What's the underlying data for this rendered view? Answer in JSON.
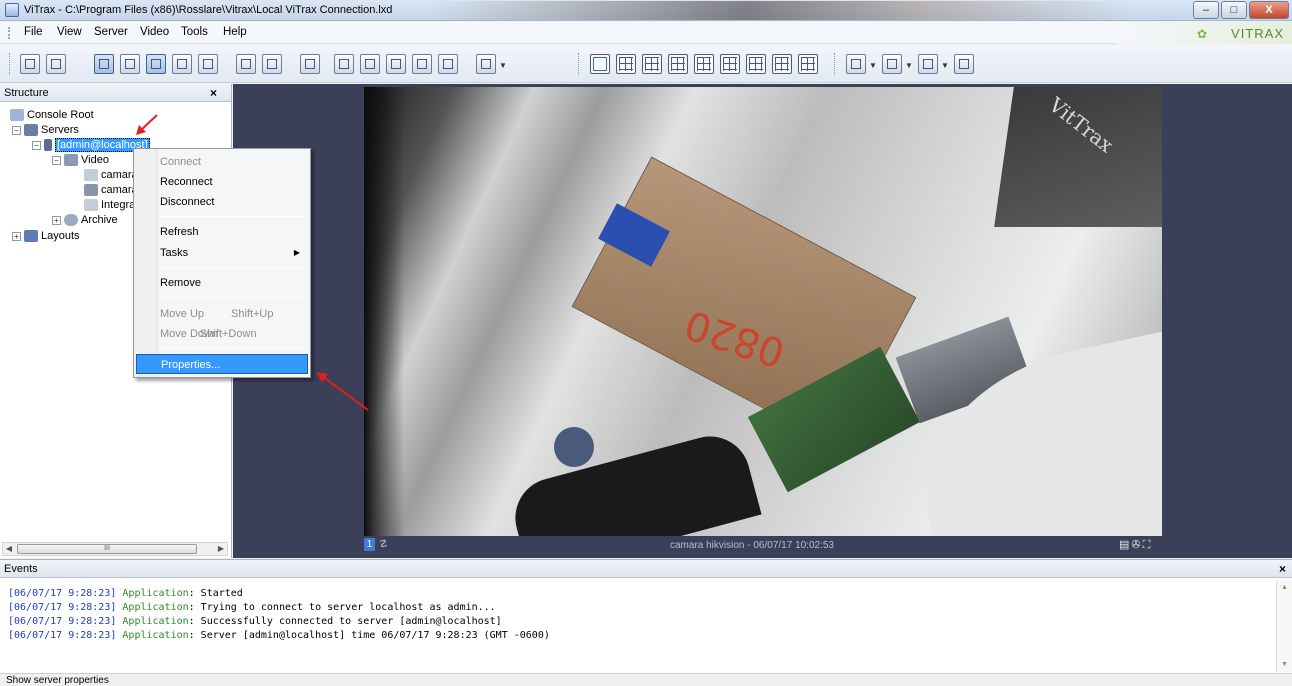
{
  "window": {
    "title": "ViTrax - C:\\Program Files (x86)\\Rosslare\\Vitrax\\Local ViTrax Connection.lxd",
    "buttons": {
      "minimize": "–",
      "maximize": "□",
      "close": "X"
    }
  },
  "menubar": {
    "items": [
      "File",
      "View",
      "Server",
      "Video",
      "Tools",
      "Help"
    ],
    "brand": "VITRAX"
  },
  "structure": {
    "title": "Structure",
    "close": "×",
    "tree": [
      {
        "label": "Console Root"
      },
      {
        "label": "Servers"
      },
      {
        "label": "[admin@localhost]"
      },
      {
        "label": "Video"
      },
      {
        "label": "camara"
      },
      {
        "label": "camara"
      },
      {
        "label": "Integra"
      },
      {
        "label": "Archive"
      },
      {
        "label": "Layouts"
      }
    ],
    "scroll_thumb": "III"
  },
  "context_menu": {
    "items": [
      {
        "label": "Connect",
        "disabled": true
      },
      {
        "label": "Reconnect"
      },
      {
        "label": "Disconnect"
      },
      {
        "label": "Refresh"
      },
      {
        "label": "Tasks",
        "submenu": "▶"
      },
      {
        "label": "Remove"
      },
      {
        "label": "Move Up",
        "shortcut": "Shift+Up",
        "disabled": true
      },
      {
        "label": "Move Down",
        "shortcut": "Shift+Down",
        "disabled": true
      },
      {
        "label": "Properties...",
        "highlighted": true
      }
    ]
  },
  "video": {
    "cell_number": "1",
    "caption": "camara hikvision - 06/07/17 10:02:53",
    "box_text": "0820",
    "watermark": "VitTrax"
  },
  "events": {
    "title": "Events",
    "close": "×",
    "lines": [
      {
        "time": "[06/07/17 9:28:23]",
        "source": "Application",
        "message": ": Started"
      },
      {
        "time": "[06/07/17 9:28:23]",
        "source": "Application",
        "message": ": Trying to connect to server localhost as admin..."
      },
      {
        "time": "[06/07/17 9:28:23]",
        "source": "Application",
        "message": ": Successfully connected to server [admin@localhost]"
      },
      {
        "time": "[06/07/17 9:28:23]",
        "source": "Application",
        "message": ": Server [admin@localhost] time 06/07/17 9:28:23 (GMT -0600)"
      }
    ]
  },
  "statusbar": {
    "text": "Show server properties"
  },
  "colors": {
    "selection": "#3399ff",
    "video_background": "#3b3f58",
    "annotation_arrow": "#e0201c",
    "event_time": "#1e3cc8",
    "event_source": "#2a8a2a"
  }
}
